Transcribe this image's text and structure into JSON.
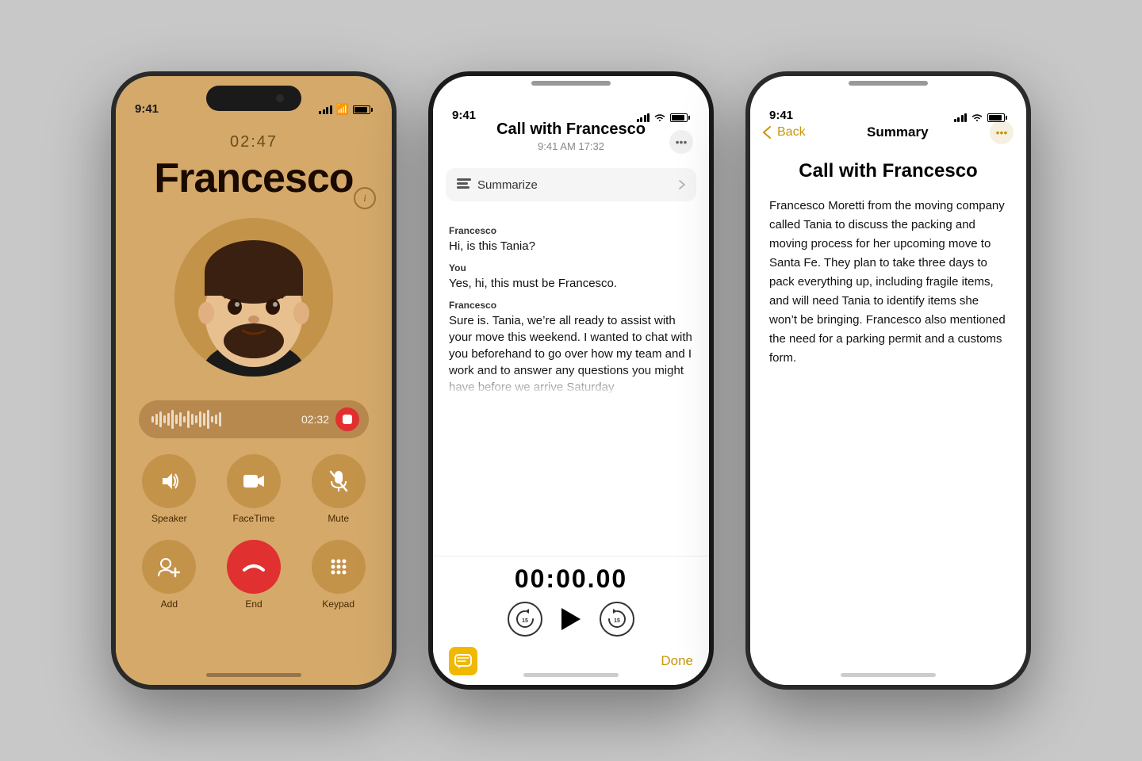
{
  "background": "#c8c8c8",
  "phone1": {
    "status_time": "9:41",
    "call_timer": "02:47",
    "caller_name": "Francesco",
    "recording_time": "02:32",
    "buttons": [
      {
        "label": "Speaker",
        "icon": "speaker-icon"
      },
      {
        "label": "FaceTime",
        "icon": "facetime-icon"
      },
      {
        "label": "Mute",
        "icon": "mute-icon"
      },
      {
        "label": "Add",
        "icon": "add-icon"
      },
      {
        "label": "End",
        "icon": "end-icon"
      },
      {
        "label": "Keypad",
        "icon": "keypad-icon"
      }
    ]
  },
  "phone2": {
    "status_time": "9:41",
    "title": "Call with Francesco",
    "subtitle": "9:41 AM  17:32",
    "summarize_label": "Summarize",
    "transcript": [
      {
        "speaker": "Francesco",
        "text": "Hi, is this Tania?"
      },
      {
        "speaker": "You",
        "text": "Yes, hi, this must be Francesco."
      },
      {
        "speaker": "Francesco",
        "text": "Sure is. Tania, we’re all ready to assist with your move this weekend. I wanted to chat with you beforehand to go over how my team and I work and to answer any questions you might have before we arrive Saturday"
      }
    ],
    "playback_time": "00:00.00",
    "done_label": "Done"
  },
  "phone3": {
    "status_time": "9:41",
    "back_label": "Back",
    "nav_title": "Summary",
    "title": "Call with Francesco",
    "summary_text": "Francesco Moretti from the moving company called Tania to discuss the packing and moving process for her upcoming move to Santa Fe. They plan to take three days to pack everything up, including fragile items, and will need Tania to identify items she won’t be bringing. Francesco also mentioned the need for a parking permit and a customs form."
  }
}
